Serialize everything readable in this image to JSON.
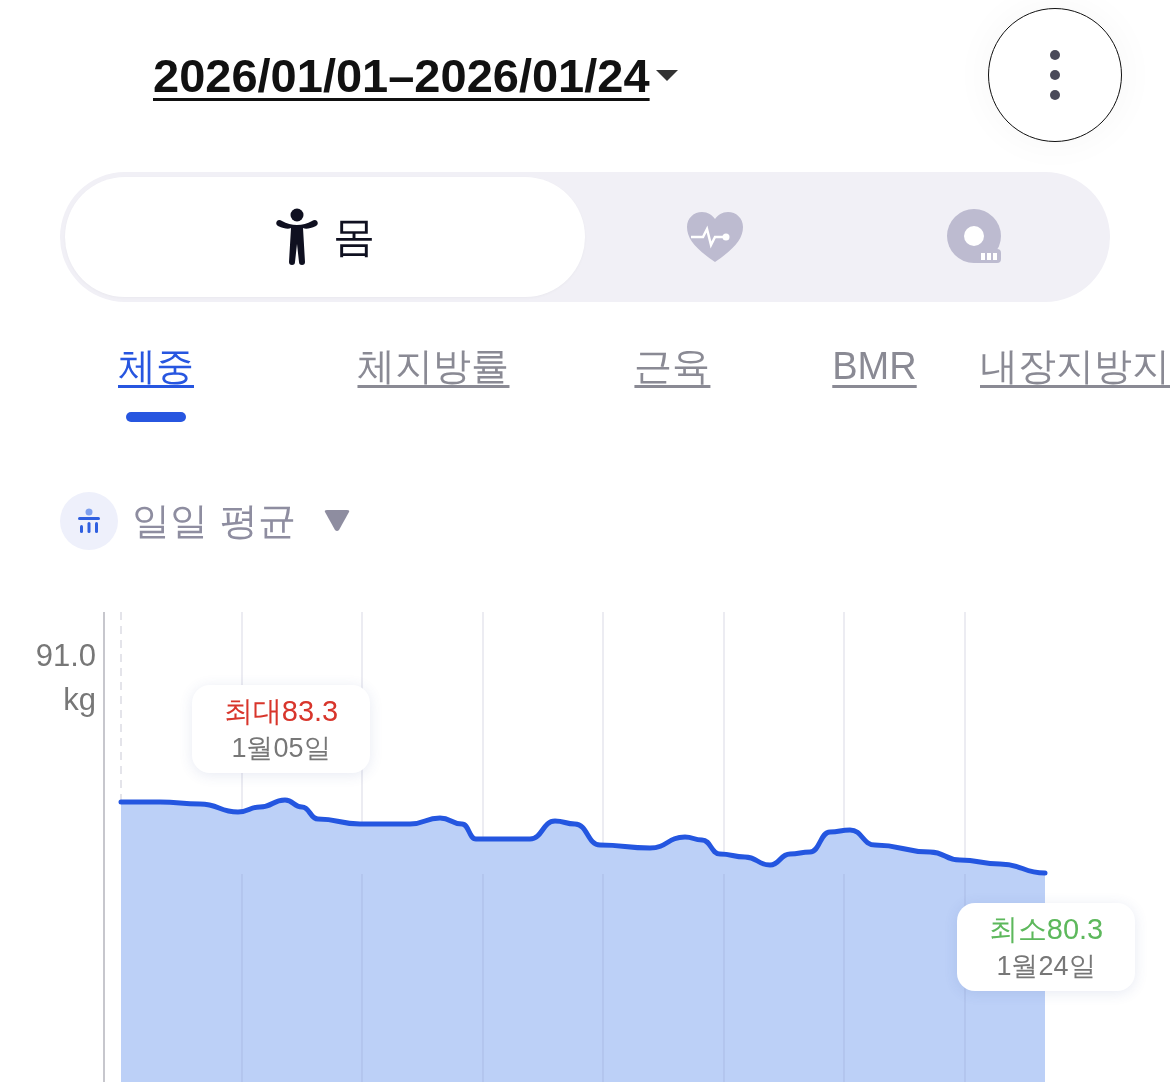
{
  "header": {
    "date_range": "2026/01/01–2026/01/24"
  },
  "categories": [
    {
      "kind": "body",
      "label": "몸",
      "selected": true
    },
    {
      "kind": "heart",
      "selected": false
    },
    {
      "kind": "tape",
      "selected": false
    }
  ],
  "metric_tabs": [
    {
      "label": "체중",
      "selected": true
    },
    {
      "label": "체지방률",
      "selected": false
    },
    {
      "label": "근육",
      "selected": false
    },
    {
      "label": "BMR",
      "selected": false
    },
    {
      "label": "내장지방지",
      "selected": false
    }
  ],
  "aggregation": {
    "label": "일일 평균"
  },
  "chart": {
    "y_tick": "91.0",
    "unit": "kg",
    "max_marker": {
      "value": "최대83.3",
      "date": "1월05일"
    },
    "min_marker": {
      "value": "최소80.3",
      "date": "1월24일"
    }
  }
}
